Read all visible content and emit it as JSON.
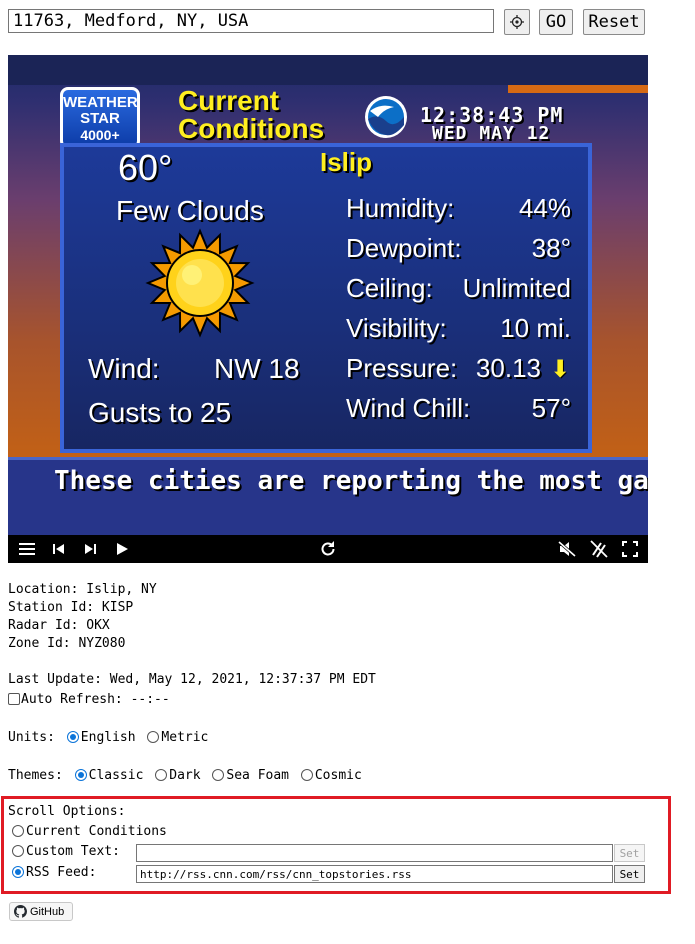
{
  "location_bar": {
    "value": "11763, Medford, NY, USA",
    "go_label": "GO",
    "reset_label": "Reset"
  },
  "weather_display": {
    "logo": [
      "WEATHER",
      "STAR",
      "4000+"
    ],
    "title_line1": "Current",
    "title_line2": "Conditions",
    "time": "12:38:43 PM",
    "date": "WED MAY 12",
    "temperature": "60°",
    "condition": "Few Clouds",
    "city": "Islip",
    "wind_label": "Wind:",
    "wind_value": "NW 18",
    "gusts": "Gusts to 25",
    "stats": [
      {
        "label": "Humidity:",
        "value": "44%"
      },
      {
        "label": "Dewpoint:",
        "value": "38°"
      },
      {
        "label": "Ceiling:",
        "value": "Unlimited"
      },
      {
        "label": "Visibility:",
        "value": "10 mi."
      },
      {
        "label": "Pressure:",
        "value": "30.13"
      },
      {
        "label": "Wind Chill:",
        "value": "57°"
      }
    ],
    "pressure_trend": "falling",
    "scroll_text": "These cities are reporting the most gas"
  },
  "info": {
    "location": "Location: Islip, NY",
    "station": "Station Id: KISP",
    "radar": "Radar Id: OKX",
    "zone": "Zone Id: NYZ080",
    "last_update": "Last Update: Wed, May 12, 2021, 12:37:37 PM EDT",
    "auto_refresh": "Auto Refresh: --:--"
  },
  "units": {
    "label": "Units:",
    "options": [
      "English",
      "Metric"
    ],
    "selected": "English"
  },
  "themes": {
    "label": "Themes:",
    "options": [
      "Classic",
      "Dark",
      "Sea Foam",
      "Cosmic"
    ],
    "selected": "Classic"
  },
  "scroll_options": {
    "label": "Scroll Options:",
    "current_conditions": "Current Conditions",
    "custom_text": "Custom Text:",
    "custom_text_value": "",
    "rss_feed": "RSS Feed:",
    "rss_value": "http://rss.cnn.com/rss/cnn_topstories.rss",
    "set_label": "Set",
    "selected": "RSS Feed"
  },
  "github_label": "GitHub"
}
